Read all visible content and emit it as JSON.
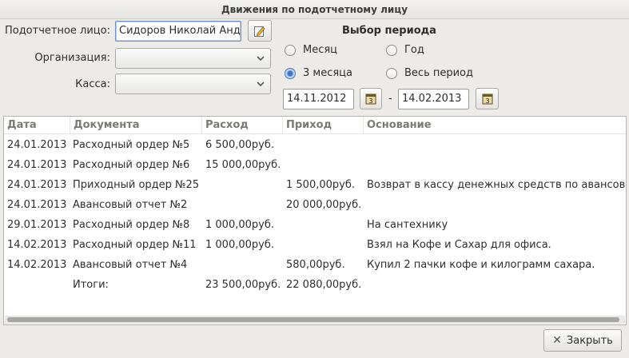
{
  "window": {
    "title": "Движения по подотчетному лицу"
  },
  "form": {
    "person_label": "Подотчетное лицо:",
    "person_value": "Сидоров Николай Анд",
    "org_label": "Организация:",
    "org_value": "",
    "cash_label": "Касса:",
    "cash_value": ""
  },
  "period": {
    "heading": "Выбор периода",
    "options": [
      {
        "label": "Месяц",
        "selected": false
      },
      {
        "label": "Год",
        "selected": false
      },
      {
        "label": "3 месяца",
        "selected": true
      },
      {
        "label": "Весь период",
        "selected": false
      }
    ],
    "date_from": "14.11.2012",
    "separator": "-",
    "date_to": "14.02.2013"
  },
  "table": {
    "columns": [
      "Дата",
      "Документа",
      "Расход",
      "Приход",
      "Основание"
    ],
    "rows": [
      [
        "24.01.2013",
        "Расходный ордер №5",
        "6 500,00руб.",
        "",
        ""
      ],
      [
        "24.01.2013",
        "Расходный ордер №6",
        "15 000,00руб.",
        "",
        ""
      ],
      [
        "24.01.2013",
        "Приходный ордер №25",
        "",
        "1 500,00руб.",
        "Возврат в кассу денежных средств по авансов"
      ],
      [
        "24.01.2013",
        "Авансовый отчет №2",
        "",
        "20 000,00руб.",
        ""
      ],
      [
        "29.01.2013",
        "Расходный ордер №8",
        "1 000,00руб.",
        "",
        "На сантехнику"
      ],
      [
        "14.02.2013",
        "Расходный ордер №11",
        "1 000,00руб.",
        "",
        "Взял на Кофе и Сахар для офиса."
      ],
      [
        "14.02.2013",
        "Авансовый отчет №4",
        "",
        "580,00руб.",
        "Купил 2 пачки кофе и килограмм сахара."
      ],
      [
        "",
        "Итоги:",
        "23 500,00руб.",
        "22 080,00руб.",
        ""
      ]
    ]
  },
  "footer": {
    "close_label": "Закрыть"
  },
  "icons": {
    "edit": "edit-icon",
    "calendar": "calendar-icon",
    "close": "close-icon",
    "dropdown": "chevron-down-icon"
  }
}
